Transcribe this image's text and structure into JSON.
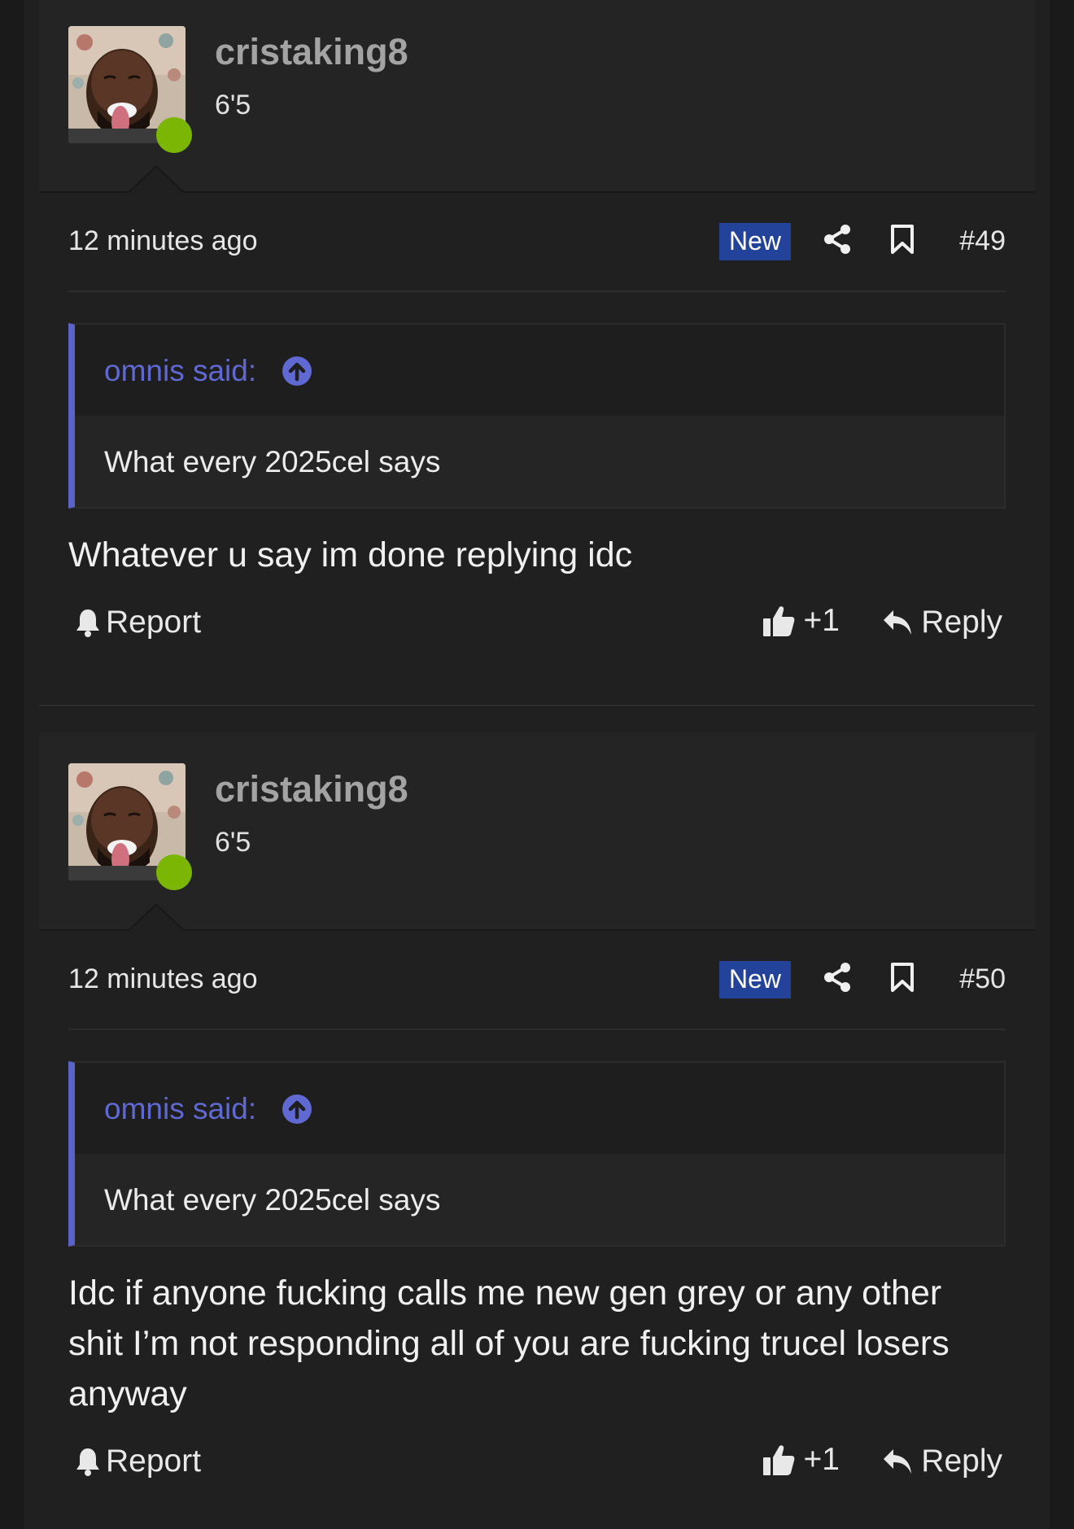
{
  "posts": [
    {
      "author": "cristaking8",
      "user_title": "6'5",
      "time": "12 minutes ago",
      "badge": "New",
      "number": "#49",
      "quote": {
        "author": "omnis said:",
        "text": "What every 2025cel says"
      },
      "message": "Whatever u say im done replying idc",
      "actions": {
        "report": "Report",
        "like": "+1",
        "reply": "Reply"
      }
    },
    {
      "author": "cristaking8",
      "user_title": "6'5",
      "time": "12 minutes ago",
      "badge": "New",
      "number": "#50",
      "quote": {
        "author": "omnis said:",
        "text": "What every 2025cel says"
      },
      "message": "Idc if anyone fucking calls me new gen grey or any other shit I’m not responding all of you are fucking trucel losers anyway",
      "actions": {
        "report": "Report",
        "like": "+1",
        "reply": "Reply"
      }
    }
  ],
  "colors": {
    "online": "#7cb604",
    "new_badge": "#23439a",
    "quote_accent": "#5b63c9",
    "username": "#a3a3a3"
  },
  "icons": {
    "online": "online-status-dot",
    "share": "share-icon",
    "bookmark": "bookmark-icon",
    "quote_jump": "arrow-up-circle-icon",
    "report": "bell-icon",
    "like": "thumbs-up-icon",
    "reply": "reply-arrow-icon"
  }
}
